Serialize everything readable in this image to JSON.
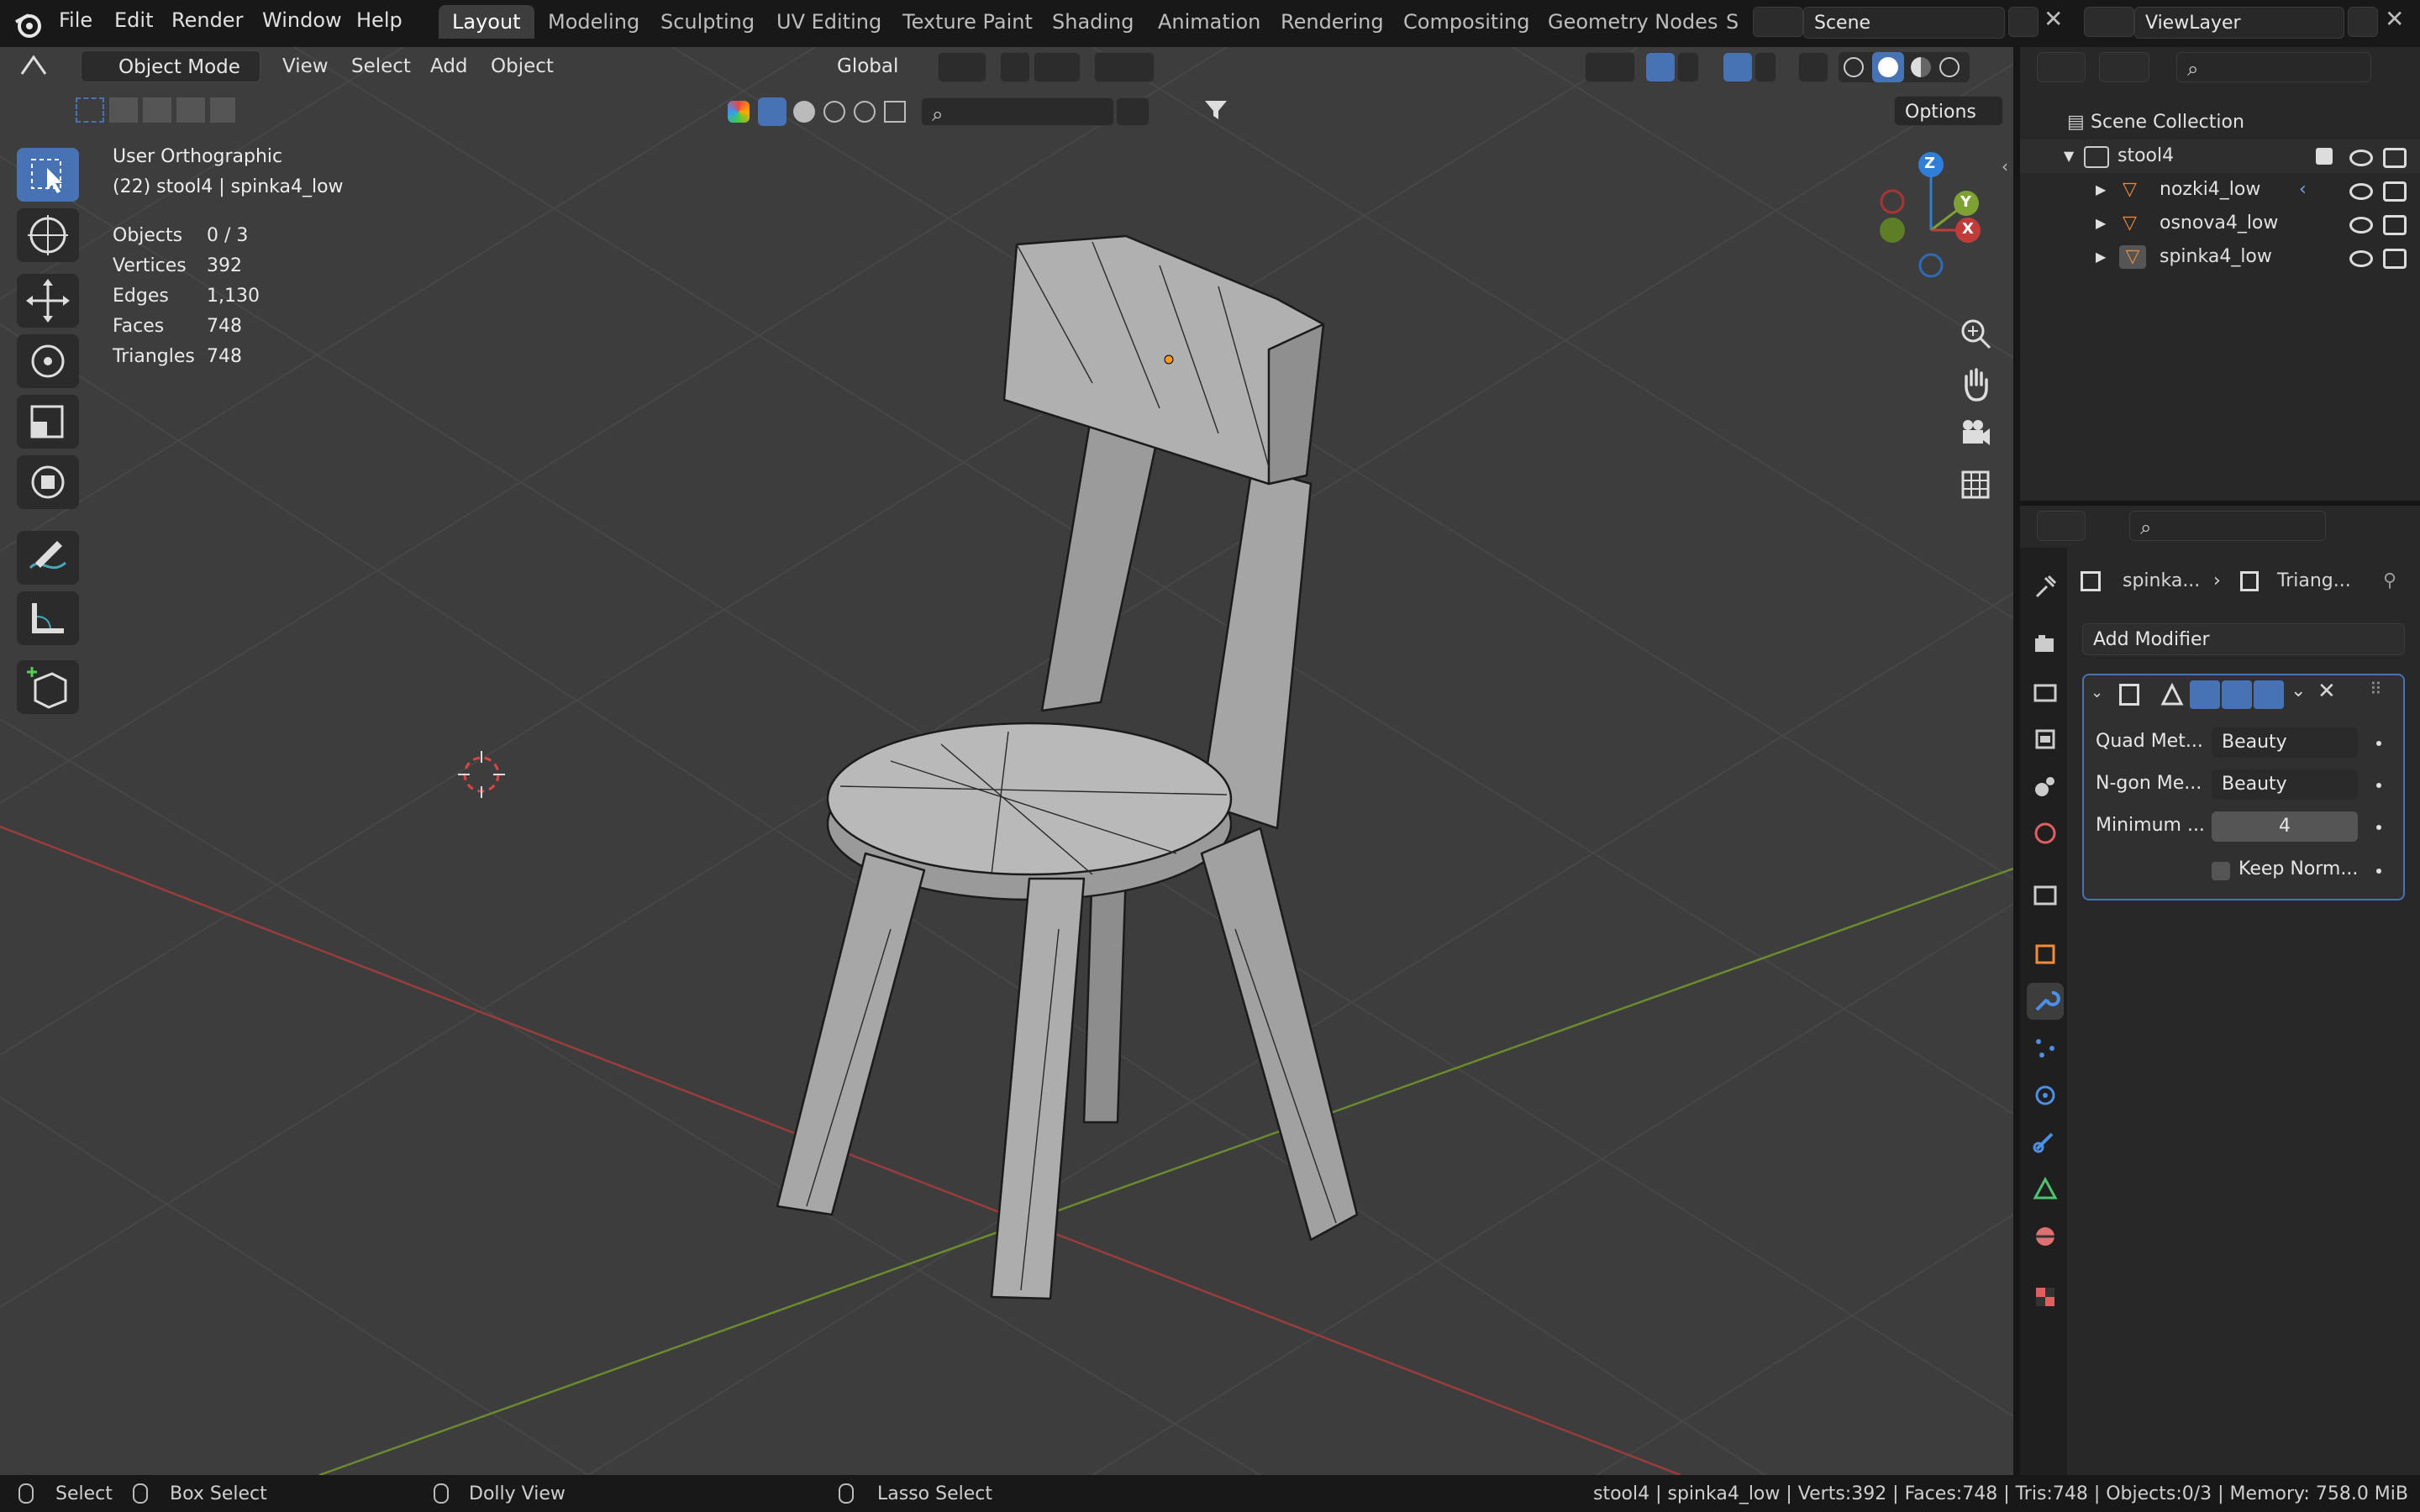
{
  "topbar": {
    "menus": [
      "File",
      "Edit",
      "Render",
      "Window",
      "Help"
    ],
    "workspaces": [
      "Layout",
      "Modeling",
      "Sculpting",
      "UV Editing",
      "Texture Paint",
      "Shading",
      "Animation",
      "Rendering",
      "Compositing",
      "Geometry Nodes",
      "S"
    ],
    "scene": "Scene",
    "view_layer": "ViewLayer"
  },
  "viewport": {
    "mode": "Object Mode",
    "menus": [
      "View",
      "Select",
      "Add",
      "Object"
    ],
    "transform_orientation": "Global",
    "options": "Options",
    "view_name": "User Orthographic",
    "active_info": "(22) stool4 | spinka4_low",
    "stats": [
      {
        "label": "Objects",
        "value": "0 / 3"
      },
      {
        "label": "Vertices",
        "value": "392"
      },
      {
        "label": "Edges",
        "value": "1,130"
      },
      {
        "label": "Faces",
        "value": "748"
      },
      {
        "label": "Triangles",
        "value": "748"
      }
    ],
    "gizmo": {
      "x": "X",
      "y": "Y",
      "z": "Z"
    },
    "colors": {
      "x_axis": "#c23b3b",
      "y_axis": "#7ea133",
      "z_axis": "#2f7ed8",
      "active": "#4772b3"
    }
  },
  "outliner": {
    "root": "Scene Collection",
    "collection": "stool4",
    "objects": [
      "nozki4_low",
      "osnova4_low",
      "spinka4_low"
    ]
  },
  "properties": {
    "breadcrumb_object": "spinka...",
    "breadcrumb_modifier": "Triang...",
    "add_modifier": "Add Modifier",
    "modifier": {
      "quad_label": "Quad Met...",
      "quad_value": "Beauty",
      "ngon_label": "N-gon Me...",
      "ngon_value": "Beauty",
      "min_label": "Minimum ...",
      "min_value": "4",
      "keep_normals": "Keep Norm..."
    }
  },
  "statusbar": {
    "select": "Select",
    "box_select": "Box Select",
    "dolly": "Dolly View",
    "lasso": "Lasso Select",
    "info": "stool4 | spinka4_low | Verts:392 | Faces:748 | Tris:748 | Objects:0/3 | Memory: 758.0 MiB"
  }
}
